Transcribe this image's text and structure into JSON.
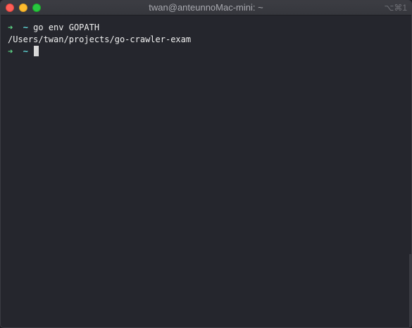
{
  "window": {
    "title": "twan@anteunnoMac-mini: ~",
    "shortcut": "⌥⌘1"
  },
  "terminal": {
    "lines": [
      {
        "type": "prompt",
        "arrow": "➜",
        "dir": "~",
        "command": "go env GOPATH"
      },
      {
        "type": "output",
        "text": "/Users/twan/projects/go-crawler-exam"
      },
      {
        "type": "prompt",
        "arrow": "➜",
        "dir": "~",
        "command": ""
      }
    ]
  },
  "colors": {
    "background": "#25262d",
    "prompt_arrow": "#5fd787",
    "prompt_dir": "#5fd7d7",
    "text": "#f0f0f0"
  }
}
